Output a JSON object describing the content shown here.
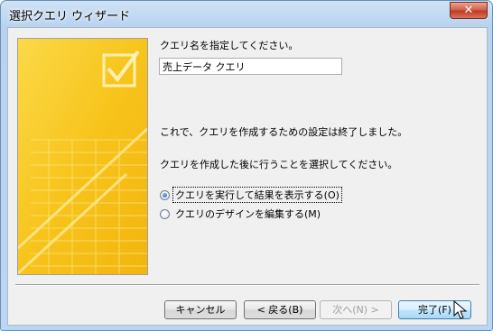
{
  "window": {
    "title": "選択クエリ ウィザード",
    "close_glyph": "✕"
  },
  "dialog": {
    "prompt_label": "クエリ名を指定してください。",
    "query_name_value": "売上データ クエリ",
    "info_finished": "これで、クエリを作成するための設定は終了しました。",
    "info_choose": "クエリを作成した後に行うことを選択してください。",
    "options": [
      {
        "label": "クエリを実行して結果を表示する(O)",
        "checked": true
      },
      {
        "label": "クエリのデザインを編集する(M)",
        "checked": false
      }
    ]
  },
  "buttons": {
    "cancel": "キャンセル",
    "back": "< 戻る(B)",
    "next": "次へ(N) >",
    "finish": "完了(F)"
  },
  "colors": {
    "art_yellow": "#f7c81e",
    "accent_blue": "#3c7fb1"
  },
  "icons": [
    "checkmark-icon",
    "mouse-cursor-icon"
  ]
}
